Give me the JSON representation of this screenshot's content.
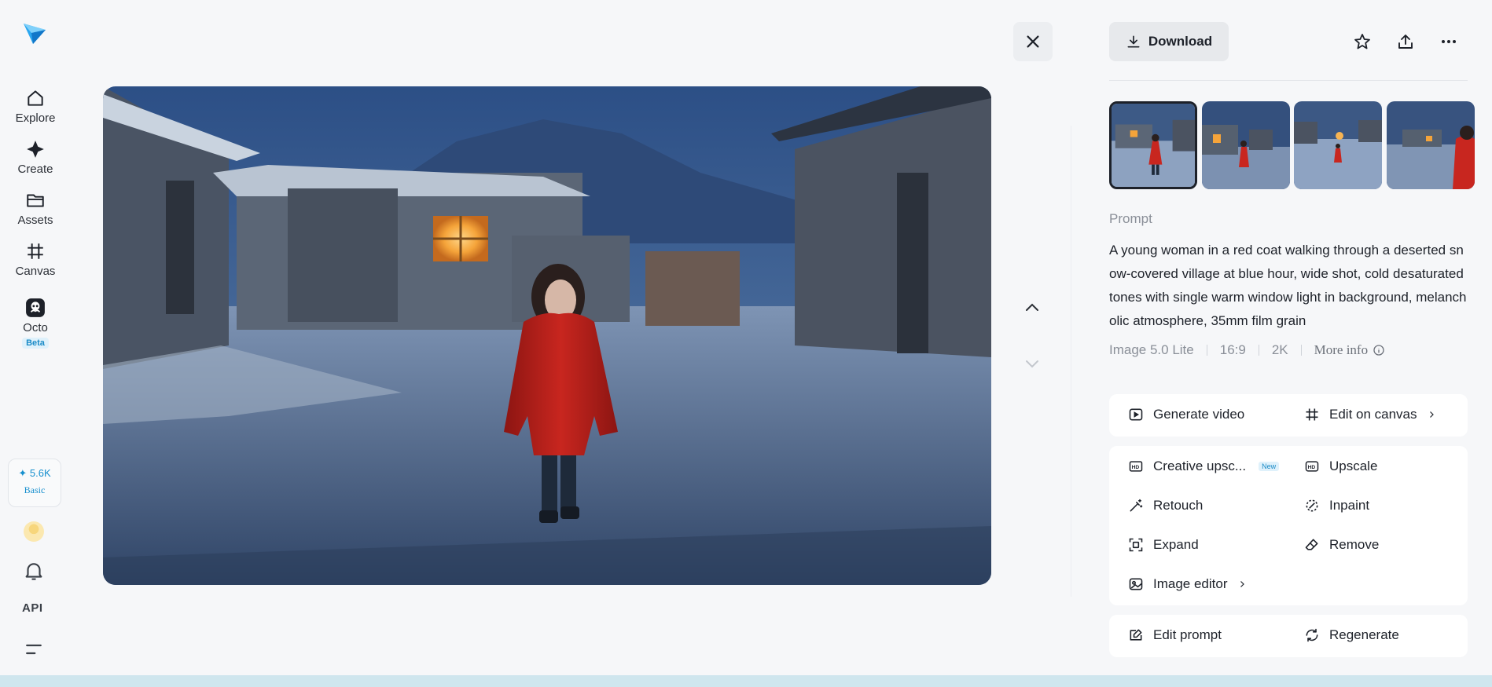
{
  "sidebar": {
    "nav": [
      {
        "label": "Explore",
        "icon": "home-icon"
      },
      {
        "label": "Create",
        "icon": "sparkle-icon"
      },
      {
        "label": "Assets",
        "icon": "folder-icon"
      },
      {
        "label": "Canvas",
        "icon": "canvas-icon"
      },
      {
        "label": "Octo",
        "icon": "octo-icon",
        "badge": "Beta"
      }
    ],
    "credits": {
      "amount": "5.6K",
      "tier": "Basic"
    },
    "api_label": "API"
  },
  "viewer": {
    "close_icon": "close-icon",
    "prev_icon": "chevron-up-icon",
    "next_icon": "chevron-down-icon"
  },
  "panel": {
    "download_label": "Download",
    "thumbnail_count": 4,
    "prompt_heading": "Prompt",
    "prompt_text": "A young woman in a red coat walking through a deserted snow-covered village at blue hour, wide shot, cold desaturated tones with single warm window light in background, melancholic atmosphere, 35mm film grain",
    "meta": {
      "model": "Image 5.0 Lite",
      "ratio": "16:9",
      "resolution": "2K",
      "more_info": "More info"
    },
    "actions_primary": [
      {
        "label": "Generate video",
        "icon": "play-icon"
      },
      {
        "label": "Edit on canvas",
        "icon": "canvas-icon"
      }
    ],
    "actions_edit": [
      {
        "label": "Creative upsc...",
        "icon": "hd-plus-icon",
        "badge": "New"
      },
      {
        "label": "Upscale",
        "icon": "hd-icon"
      },
      {
        "label": "Retouch",
        "icon": "magic-wand-icon"
      },
      {
        "label": "Inpaint",
        "icon": "inpaint-icon"
      },
      {
        "label": "Expand",
        "icon": "expand-icon"
      },
      {
        "label": "Remove",
        "icon": "eraser-icon"
      },
      {
        "label": "Image editor",
        "icon": "image-editor-icon"
      }
    ],
    "actions_bottom": [
      {
        "label": "Edit prompt",
        "icon": "edit-icon"
      },
      {
        "label": "Regenerate",
        "icon": "refresh-icon"
      }
    ]
  },
  "colors": {
    "accent": "#168fce",
    "background": "#f6f7f9",
    "coat": "#b8201c",
    "window_light": "#f5a43a"
  }
}
